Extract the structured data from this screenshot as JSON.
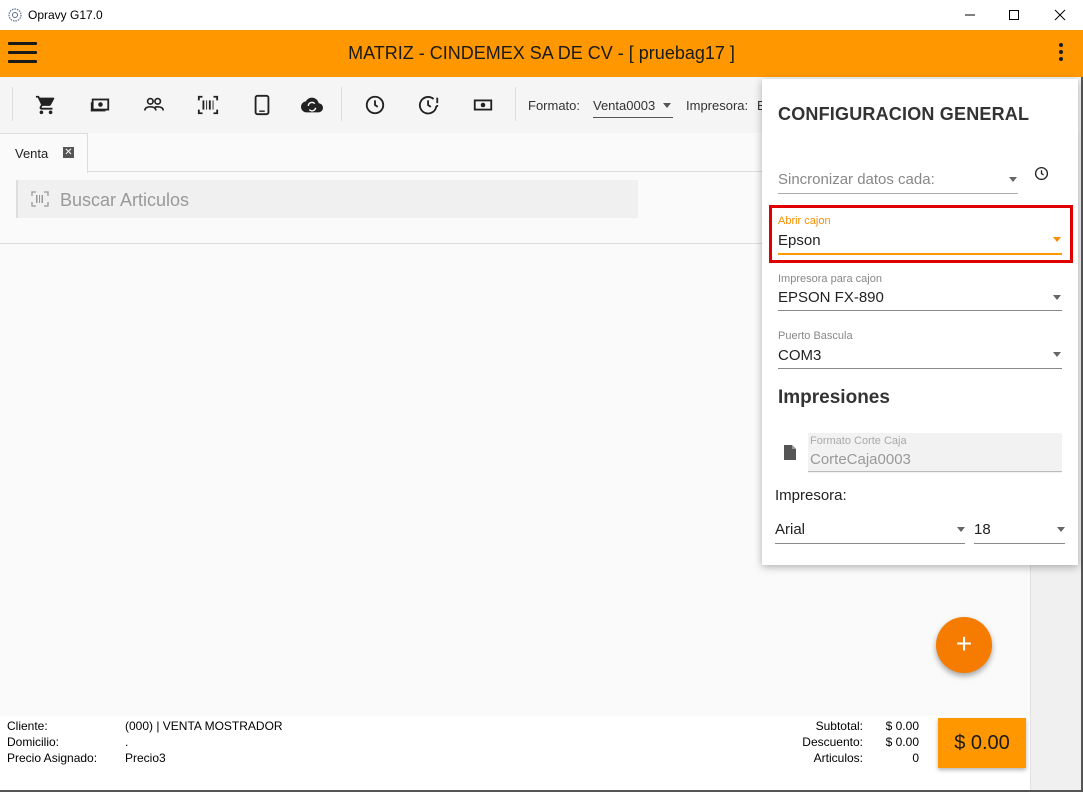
{
  "window": {
    "title": "Opravy G17.0"
  },
  "header": {
    "title": "MATRIZ - CINDEMEX SA DE CV - [ pruebag17 ]"
  },
  "toolbar": {
    "icons": [
      "cart-icon",
      "money-icon",
      "people-icon",
      "barcode-icon",
      "tablet-icon",
      "cloud-sync-icon",
      "clock-icon",
      "clock-alert-icon",
      "cash-icon"
    ],
    "formato_label": "Formato:",
    "formato_value": "Venta0003",
    "impresora_label": "Impresora:",
    "impresora_value": "E"
  },
  "tabs": [
    {
      "label": "Venta",
      "close": "✕"
    }
  ],
  "search": {
    "placeholder": "Buscar Articulos"
  },
  "config": {
    "title": "CONFIGURACION GENERAL",
    "sync_placeholder": "Sincronizar datos cada:",
    "abrir_cajon_label": "Abrir cajon",
    "abrir_cajon_value": "Epson",
    "impresora_cajon_label": "Impresora para cajon",
    "impresora_cajon_value": "EPSON FX-890",
    "puerto_label": "Puerto Bascula",
    "puerto_value": "COM3",
    "impresiones_title": "Impresiones",
    "formato_corte_label": "Formato Corte Caja",
    "formato_corte_value": "CorteCaja0003",
    "impresora_label": "Impresora:",
    "font_value": "Arial",
    "size_value": "18"
  },
  "fab": {
    "label": "+"
  },
  "footer": {
    "cliente_label": "Cliente:",
    "cliente_value": "(000) | VENTA MOSTRADOR",
    "domicilio_label": "Domicilio:",
    "domicilio_value": ".",
    "precio_label": "Precio Asignado:",
    "precio_value": "Precio3",
    "subtotal_label": "Subtotal:",
    "subtotal_value": "$ 0.00",
    "descuento_label": "Descuento:",
    "descuento_value": "$ 0.00",
    "articulos_label": "Articulos:",
    "articulos_value": "0",
    "total": "$ 0.00"
  },
  "colors": {
    "accent": "#ff9800",
    "fab": "#f57c00",
    "highlight": "#e00000"
  }
}
